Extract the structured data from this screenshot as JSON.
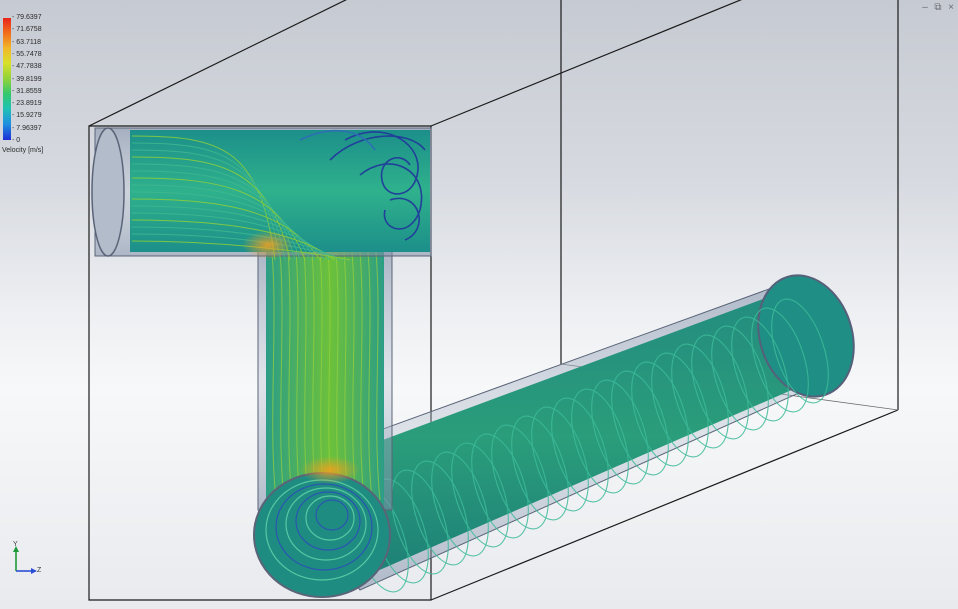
{
  "legend": {
    "ticks": [
      "79.6397",
      "71.6758",
      "63.7118",
      "55.7478",
      "47.7838",
      "39.8199",
      "31.8559",
      "23.8919",
      "15.9279",
      "7.96397",
      "0"
    ],
    "title": "Velocity [m/s]",
    "gradient_colors": [
      "#e8231c",
      "#f26b1a",
      "#f1b82a",
      "#d8e02a",
      "#8fd33a",
      "#35c86a",
      "#1fc2b4",
      "#1f8fe0",
      "#1c2fd6"
    ]
  },
  "window_controls": {
    "minimize_glyph": "–",
    "restore_glyph": "⧉",
    "close_glyph": "×"
  },
  "triad": {
    "y_label": "Y",
    "z_label": "Z"
  },
  "scene": {
    "streamline_color": "#1f9a8c",
    "high_velocity_color": "#e0a030",
    "pipe_color": "#9aa3b4"
  }
}
